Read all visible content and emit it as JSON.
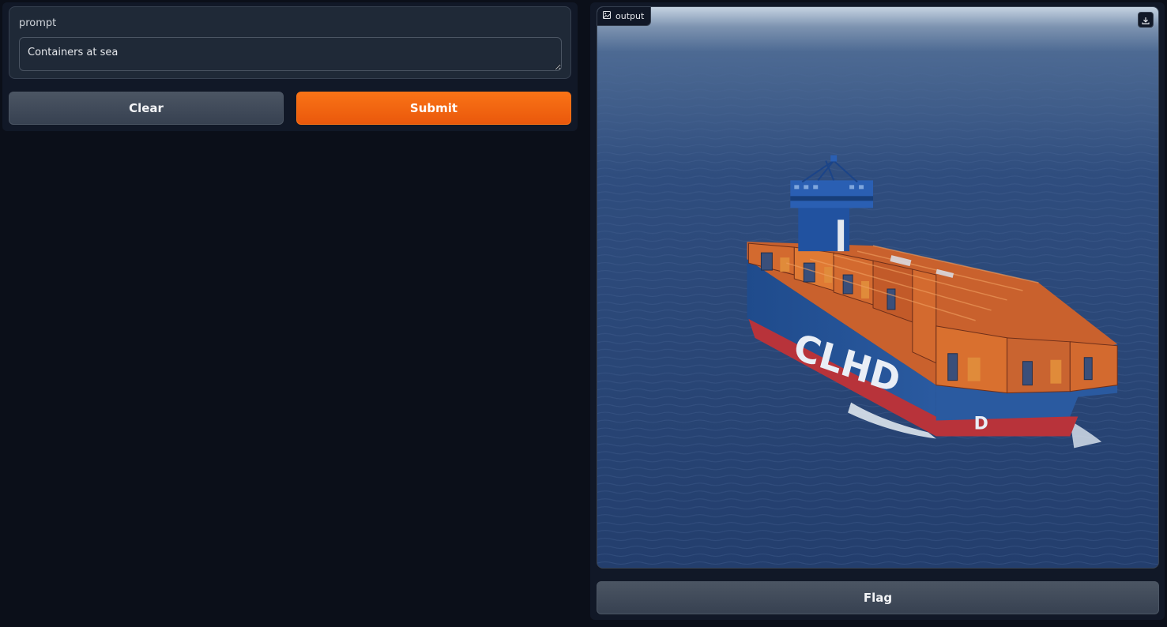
{
  "input": {
    "label": "prompt",
    "value": "Containers at sea"
  },
  "buttons": {
    "clear": "Clear",
    "submit": "Submit",
    "flag": "Flag"
  },
  "output": {
    "label": "output",
    "label_icon": "image-icon",
    "download_icon": "download-icon",
    "image_content": {
      "hull_text": "CLHD",
      "stern_text": "D"
    }
  },
  "colors": {
    "background": "#0b0f19",
    "panel": "#111827",
    "primary": "#f97316",
    "secondary": "#4b5563"
  }
}
